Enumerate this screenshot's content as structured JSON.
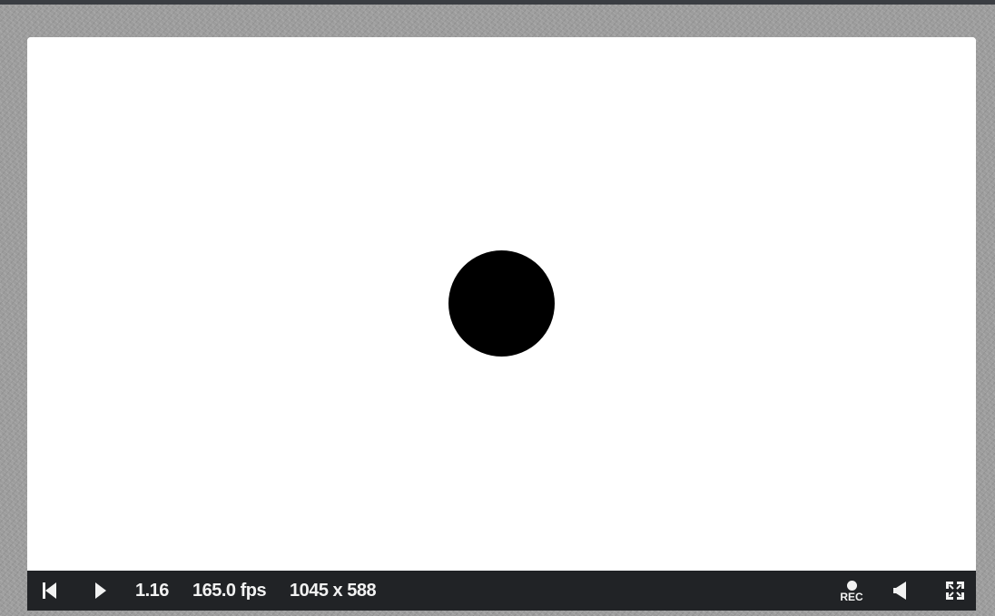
{
  "player": {
    "time": "1.16",
    "fps": "165.0 fps",
    "resolution": "1045 x 588",
    "record_label": "REC"
  },
  "icons": {
    "rewind": "skip-to-start-icon",
    "play": "play-icon",
    "record": "record-icon",
    "volume": "volume-icon",
    "fullscreen": "fullscreen-icon"
  },
  "colors": {
    "canvas_background": "#ffffff",
    "shape_fill": "#000000",
    "control_bar": "#212326",
    "page_background": "#9c9c9c",
    "control_text": "#f2f2f2"
  }
}
